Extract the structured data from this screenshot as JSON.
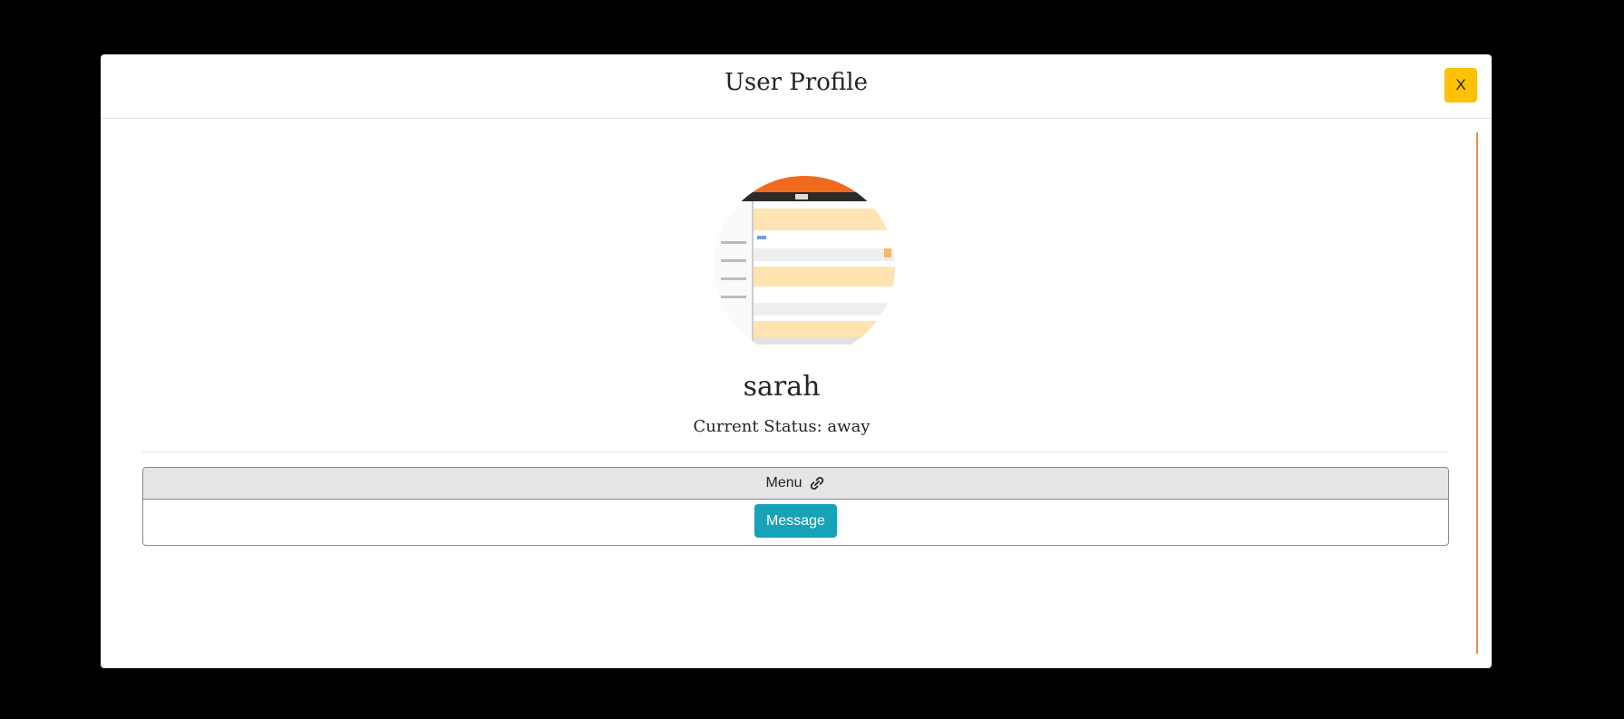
{
  "modal": {
    "title": "User Profile",
    "close_label": "X"
  },
  "profile": {
    "username": "sarah",
    "status_text": "Current Status: away"
  },
  "menu": {
    "header_label": "Menu",
    "header_icon": "link-icon",
    "message_label": "Message"
  },
  "colors": {
    "close_button": "#ffc107",
    "message_button": "#17a2b8",
    "scroll_indicator": "#f08a4b"
  }
}
